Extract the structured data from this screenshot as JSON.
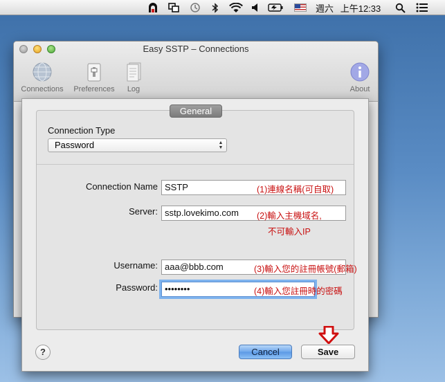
{
  "menubar": {
    "day": "週六",
    "time": "上午12:33"
  },
  "window": {
    "title": "Easy SSTP – Connections",
    "toolbar": [
      {
        "label": "Connections"
      },
      {
        "label": "Preferences"
      },
      {
        "label": "Log"
      },
      {
        "label": "About"
      }
    ]
  },
  "sheet": {
    "tab_label": "General",
    "connection_type_label": "Connection Type",
    "connection_type_value": "Password",
    "connection_name_label": "Connection Name",
    "connection_name_value": "SSTP",
    "server_label": "Server:",
    "server_value": "sstp.lovekimo.com",
    "username_label": "Username:",
    "username_value": "aaa@bbb.com",
    "password_label": "Password:",
    "password_value": "••••••••",
    "notes": {
      "name": "(1)連線名稱(可自取)",
      "server_1": "(2)輸入主機域名,",
      "server_2": "不可輸入IP",
      "username": "(3)輸入您的註冊帳號(郵箱)",
      "password": "(4)輸入您註冊時的密碼"
    },
    "help_label": "?",
    "cancel_label": "Cancel",
    "save_label": "Save"
  },
  "colors": {
    "annotation": "#c81010",
    "arrow": "#d01010",
    "focus_ring": "#7eb3ee"
  }
}
